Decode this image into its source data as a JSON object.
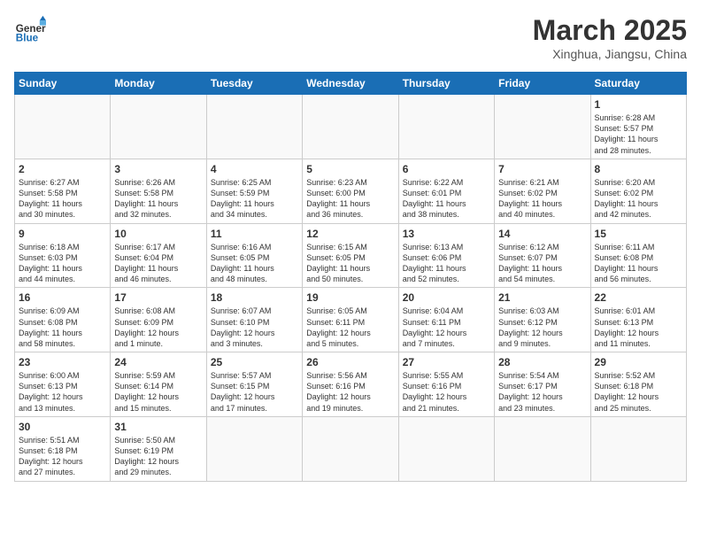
{
  "header": {
    "logo_general": "General",
    "logo_blue": "Blue",
    "month_title": "March 2025",
    "subtitle": "Xinghua, Jiangsu, China"
  },
  "days_of_week": [
    "Sunday",
    "Monday",
    "Tuesday",
    "Wednesday",
    "Thursday",
    "Friday",
    "Saturday"
  ],
  "weeks": [
    [
      {
        "day": "",
        "info": ""
      },
      {
        "day": "",
        "info": ""
      },
      {
        "day": "",
        "info": ""
      },
      {
        "day": "",
        "info": ""
      },
      {
        "day": "",
        "info": ""
      },
      {
        "day": "",
        "info": ""
      },
      {
        "day": "1",
        "info": "Sunrise: 6:28 AM\nSunset: 5:57 PM\nDaylight: 11 hours\nand 28 minutes."
      }
    ],
    [
      {
        "day": "2",
        "info": "Sunrise: 6:27 AM\nSunset: 5:58 PM\nDaylight: 11 hours\nand 30 minutes."
      },
      {
        "day": "3",
        "info": "Sunrise: 6:26 AM\nSunset: 5:58 PM\nDaylight: 11 hours\nand 32 minutes."
      },
      {
        "day": "4",
        "info": "Sunrise: 6:25 AM\nSunset: 5:59 PM\nDaylight: 11 hours\nand 34 minutes."
      },
      {
        "day": "5",
        "info": "Sunrise: 6:23 AM\nSunset: 6:00 PM\nDaylight: 11 hours\nand 36 minutes."
      },
      {
        "day": "6",
        "info": "Sunrise: 6:22 AM\nSunset: 6:01 PM\nDaylight: 11 hours\nand 38 minutes."
      },
      {
        "day": "7",
        "info": "Sunrise: 6:21 AM\nSunset: 6:02 PM\nDaylight: 11 hours\nand 40 minutes."
      },
      {
        "day": "8",
        "info": "Sunrise: 6:20 AM\nSunset: 6:02 PM\nDaylight: 11 hours\nand 42 minutes."
      }
    ],
    [
      {
        "day": "9",
        "info": "Sunrise: 6:18 AM\nSunset: 6:03 PM\nDaylight: 11 hours\nand 44 minutes."
      },
      {
        "day": "10",
        "info": "Sunrise: 6:17 AM\nSunset: 6:04 PM\nDaylight: 11 hours\nand 46 minutes."
      },
      {
        "day": "11",
        "info": "Sunrise: 6:16 AM\nSunset: 6:05 PM\nDaylight: 11 hours\nand 48 minutes."
      },
      {
        "day": "12",
        "info": "Sunrise: 6:15 AM\nSunset: 6:05 PM\nDaylight: 11 hours\nand 50 minutes."
      },
      {
        "day": "13",
        "info": "Sunrise: 6:13 AM\nSunset: 6:06 PM\nDaylight: 11 hours\nand 52 minutes."
      },
      {
        "day": "14",
        "info": "Sunrise: 6:12 AM\nSunset: 6:07 PM\nDaylight: 11 hours\nand 54 minutes."
      },
      {
        "day": "15",
        "info": "Sunrise: 6:11 AM\nSunset: 6:08 PM\nDaylight: 11 hours\nand 56 minutes."
      }
    ],
    [
      {
        "day": "16",
        "info": "Sunrise: 6:09 AM\nSunset: 6:08 PM\nDaylight: 11 hours\nand 58 minutes."
      },
      {
        "day": "17",
        "info": "Sunrise: 6:08 AM\nSunset: 6:09 PM\nDaylight: 12 hours\nand 1 minute."
      },
      {
        "day": "18",
        "info": "Sunrise: 6:07 AM\nSunset: 6:10 PM\nDaylight: 12 hours\nand 3 minutes."
      },
      {
        "day": "19",
        "info": "Sunrise: 6:05 AM\nSunset: 6:11 PM\nDaylight: 12 hours\nand 5 minutes."
      },
      {
        "day": "20",
        "info": "Sunrise: 6:04 AM\nSunset: 6:11 PM\nDaylight: 12 hours\nand 7 minutes."
      },
      {
        "day": "21",
        "info": "Sunrise: 6:03 AM\nSunset: 6:12 PM\nDaylight: 12 hours\nand 9 minutes."
      },
      {
        "day": "22",
        "info": "Sunrise: 6:01 AM\nSunset: 6:13 PM\nDaylight: 12 hours\nand 11 minutes."
      }
    ],
    [
      {
        "day": "23",
        "info": "Sunrise: 6:00 AM\nSunset: 6:13 PM\nDaylight: 12 hours\nand 13 minutes."
      },
      {
        "day": "24",
        "info": "Sunrise: 5:59 AM\nSunset: 6:14 PM\nDaylight: 12 hours\nand 15 minutes."
      },
      {
        "day": "25",
        "info": "Sunrise: 5:57 AM\nSunset: 6:15 PM\nDaylight: 12 hours\nand 17 minutes."
      },
      {
        "day": "26",
        "info": "Sunrise: 5:56 AM\nSunset: 6:16 PM\nDaylight: 12 hours\nand 19 minutes."
      },
      {
        "day": "27",
        "info": "Sunrise: 5:55 AM\nSunset: 6:16 PM\nDaylight: 12 hours\nand 21 minutes."
      },
      {
        "day": "28",
        "info": "Sunrise: 5:54 AM\nSunset: 6:17 PM\nDaylight: 12 hours\nand 23 minutes."
      },
      {
        "day": "29",
        "info": "Sunrise: 5:52 AM\nSunset: 6:18 PM\nDaylight: 12 hours\nand 25 minutes."
      }
    ],
    [
      {
        "day": "30",
        "info": "Sunrise: 5:51 AM\nSunset: 6:18 PM\nDaylight: 12 hours\nand 27 minutes."
      },
      {
        "day": "31",
        "info": "Sunrise: 5:50 AM\nSunset: 6:19 PM\nDaylight: 12 hours\nand 29 minutes."
      },
      {
        "day": "",
        "info": ""
      },
      {
        "day": "",
        "info": ""
      },
      {
        "day": "",
        "info": ""
      },
      {
        "day": "",
        "info": ""
      },
      {
        "day": "",
        "info": ""
      }
    ]
  ]
}
